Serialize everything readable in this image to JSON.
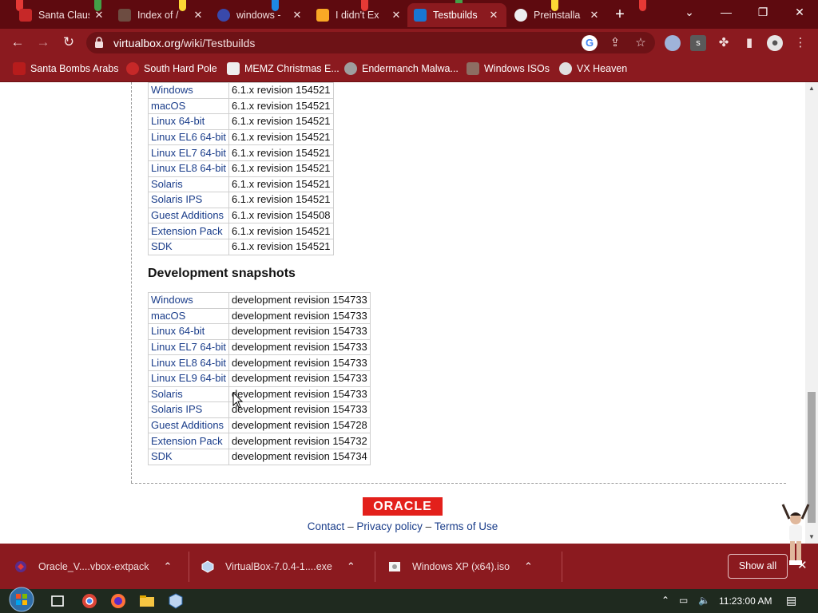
{
  "tabs": [
    {
      "label": "Santa Claus",
      "active": false
    },
    {
      "label": "Index of /",
      "active": false
    },
    {
      "label": "windows -",
      "active": false
    },
    {
      "label": "I didn't Ex",
      "active": false
    },
    {
      "label": "Testbuilds",
      "active": true
    },
    {
      "label": "Preinstalla",
      "active": false
    }
  ],
  "toolbar": {
    "url_host": "virtualbox.org",
    "url_path": "/wiki/Testbuilds"
  },
  "bookmarks": [
    {
      "label": "Santa Bombs Arabs"
    },
    {
      "label": "South Hard Pole"
    },
    {
      "label": "MEMZ Christmas E..."
    },
    {
      "label": "Endermanch Malwa..."
    },
    {
      "label": "Windows ISOs"
    },
    {
      "label": "VX Heaven"
    }
  ],
  "stable_table": {
    "rows": [
      {
        "name": "Windows",
        "value": "6.1.x revision 154521"
      },
      {
        "name": "macOS",
        "value": "6.1.x revision 154521"
      },
      {
        "name": "Linux 64-bit",
        "value": "6.1.x revision 154521"
      },
      {
        "name": "Linux EL6 64-bit",
        "value": "6.1.x revision 154521"
      },
      {
        "name": "Linux EL7 64-bit",
        "value": "6.1.x revision 154521"
      },
      {
        "name": "Linux EL8 64-bit",
        "value": "6.1.x revision 154521"
      },
      {
        "name": "Solaris",
        "value": "6.1.x revision 154521"
      },
      {
        "name": "Solaris IPS",
        "value": "6.1.x revision 154521"
      },
      {
        "name": "Guest Additions",
        "value": "6.1.x revision 154508"
      },
      {
        "name": "Extension Pack",
        "value": "6.1.x revision 154521"
      },
      {
        "name": "SDK",
        "value": "6.1.x revision 154521"
      }
    ]
  },
  "dev_section": {
    "heading": "Development snapshots",
    "rows": [
      {
        "name": "Windows",
        "value": "development revision 154733"
      },
      {
        "name": "macOS",
        "value": "development revision 154733"
      },
      {
        "name": "Linux 64-bit",
        "value": "development revision 154733"
      },
      {
        "name": "Linux EL7 64-bit",
        "value": "development revision 154733"
      },
      {
        "name": "Linux EL8 64-bit",
        "value": "development revision 154733"
      },
      {
        "name": "Linux EL9 64-bit",
        "value": "development revision 154733"
      },
      {
        "name": "Solaris",
        "value": "development revision 154733"
      },
      {
        "name": "Solaris IPS",
        "value": "development revision 154733"
      },
      {
        "name": "Guest Additions",
        "value": "development revision 154728"
      },
      {
        "name": "Extension Pack",
        "value": "development revision 154732"
      },
      {
        "name": "SDK",
        "value": "development revision 154734"
      }
    ]
  },
  "footer": {
    "logo_text": "ORACLE",
    "contact": "Contact",
    "privacy": "Privacy policy",
    "terms": "Terms of Use",
    "sep": "–"
  },
  "downloads": {
    "items": [
      {
        "label": "Oracle_V....vbox-extpack"
      },
      {
        "label": "VirtualBox-7.0.4-1....exe"
      },
      {
        "label": "Windows XP (x64).iso"
      }
    ],
    "show_all": "Show all"
  },
  "taskbar": {
    "clock": "11:23:00 AM"
  },
  "colors": {
    "chrome_dark": "#5e0a0f",
    "chrome": "#8b1a1f",
    "link": "#1a3d8a",
    "oracle_red": "#e3201b"
  }
}
